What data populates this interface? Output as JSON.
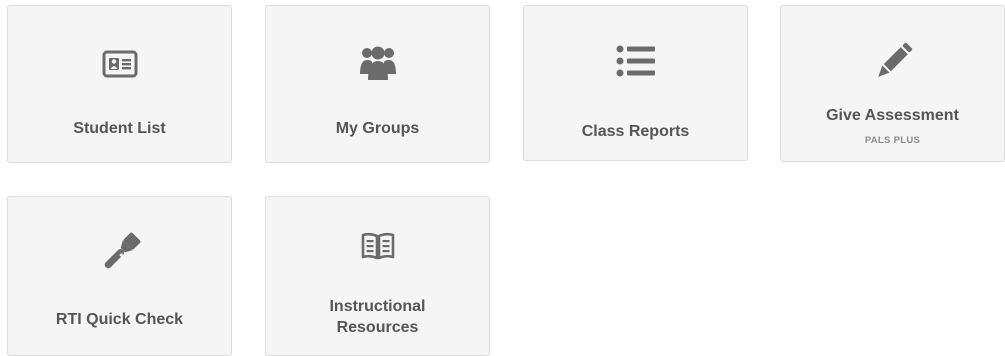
{
  "colors": {
    "tile_background": "#f5f5f5",
    "tile_border": "#dcdcdc",
    "icon": "#6b6b6b",
    "label": "#555555",
    "sublabel": "#8a8a8a"
  },
  "tiles": [
    {
      "label": "Student List",
      "icon": "id-card-icon"
    },
    {
      "label": "My Groups",
      "icon": "group-icon"
    },
    {
      "label": "Class Reports",
      "icon": "list-icon"
    },
    {
      "label": "Give Assessment",
      "sublabel": "PALS PLUS",
      "icon": "pencil-icon"
    },
    {
      "label": "RTI Quick Check",
      "icon": "flashlight-icon"
    },
    {
      "label": "Instructional Resources",
      "icon": "book-icon"
    }
  ]
}
